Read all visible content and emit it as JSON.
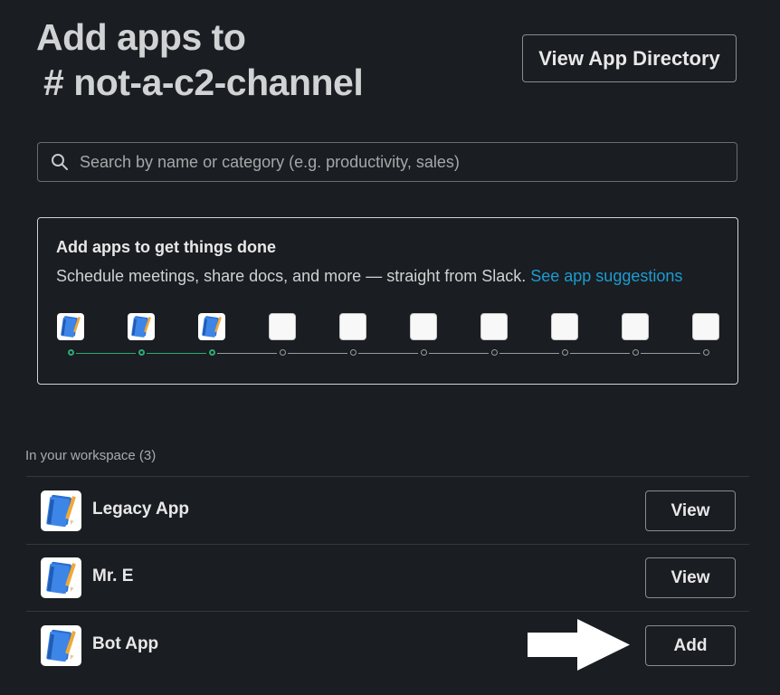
{
  "header": {
    "title_line1": "Add apps to",
    "title_line2": "# not-a-c2-channel",
    "directory_button": "View App Directory"
  },
  "search": {
    "placeholder": "Search by name or category (e.g. productivity, sales)",
    "value": ""
  },
  "promo": {
    "title": "Add apps to get things done",
    "text": "Schedule meetings, share docs, and more — straight from Slack. ",
    "link": "See app suggestions",
    "progress": {
      "filled": 3,
      "total": 10
    }
  },
  "workspace": {
    "label": "In your workspace (3)",
    "apps": [
      {
        "name": "Legacy App",
        "action": "View",
        "icon": "notebook-pencil-icon"
      },
      {
        "name": "Mr. E",
        "action": "View",
        "icon": "notebook-pencil-icon"
      },
      {
        "name": "Bot App",
        "action": "Add",
        "icon": "notebook-pencil-icon"
      }
    ]
  },
  "colors": {
    "background": "#1a1d21",
    "text": "#d1d2d3",
    "link": "#1d9bd1",
    "progress_done": "#2bac76",
    "divider": "#35373b"
  },
  "icons": {
    "search": "search-icon",
    "annotation_arrow": "arrow-right-icon"
  }
}
